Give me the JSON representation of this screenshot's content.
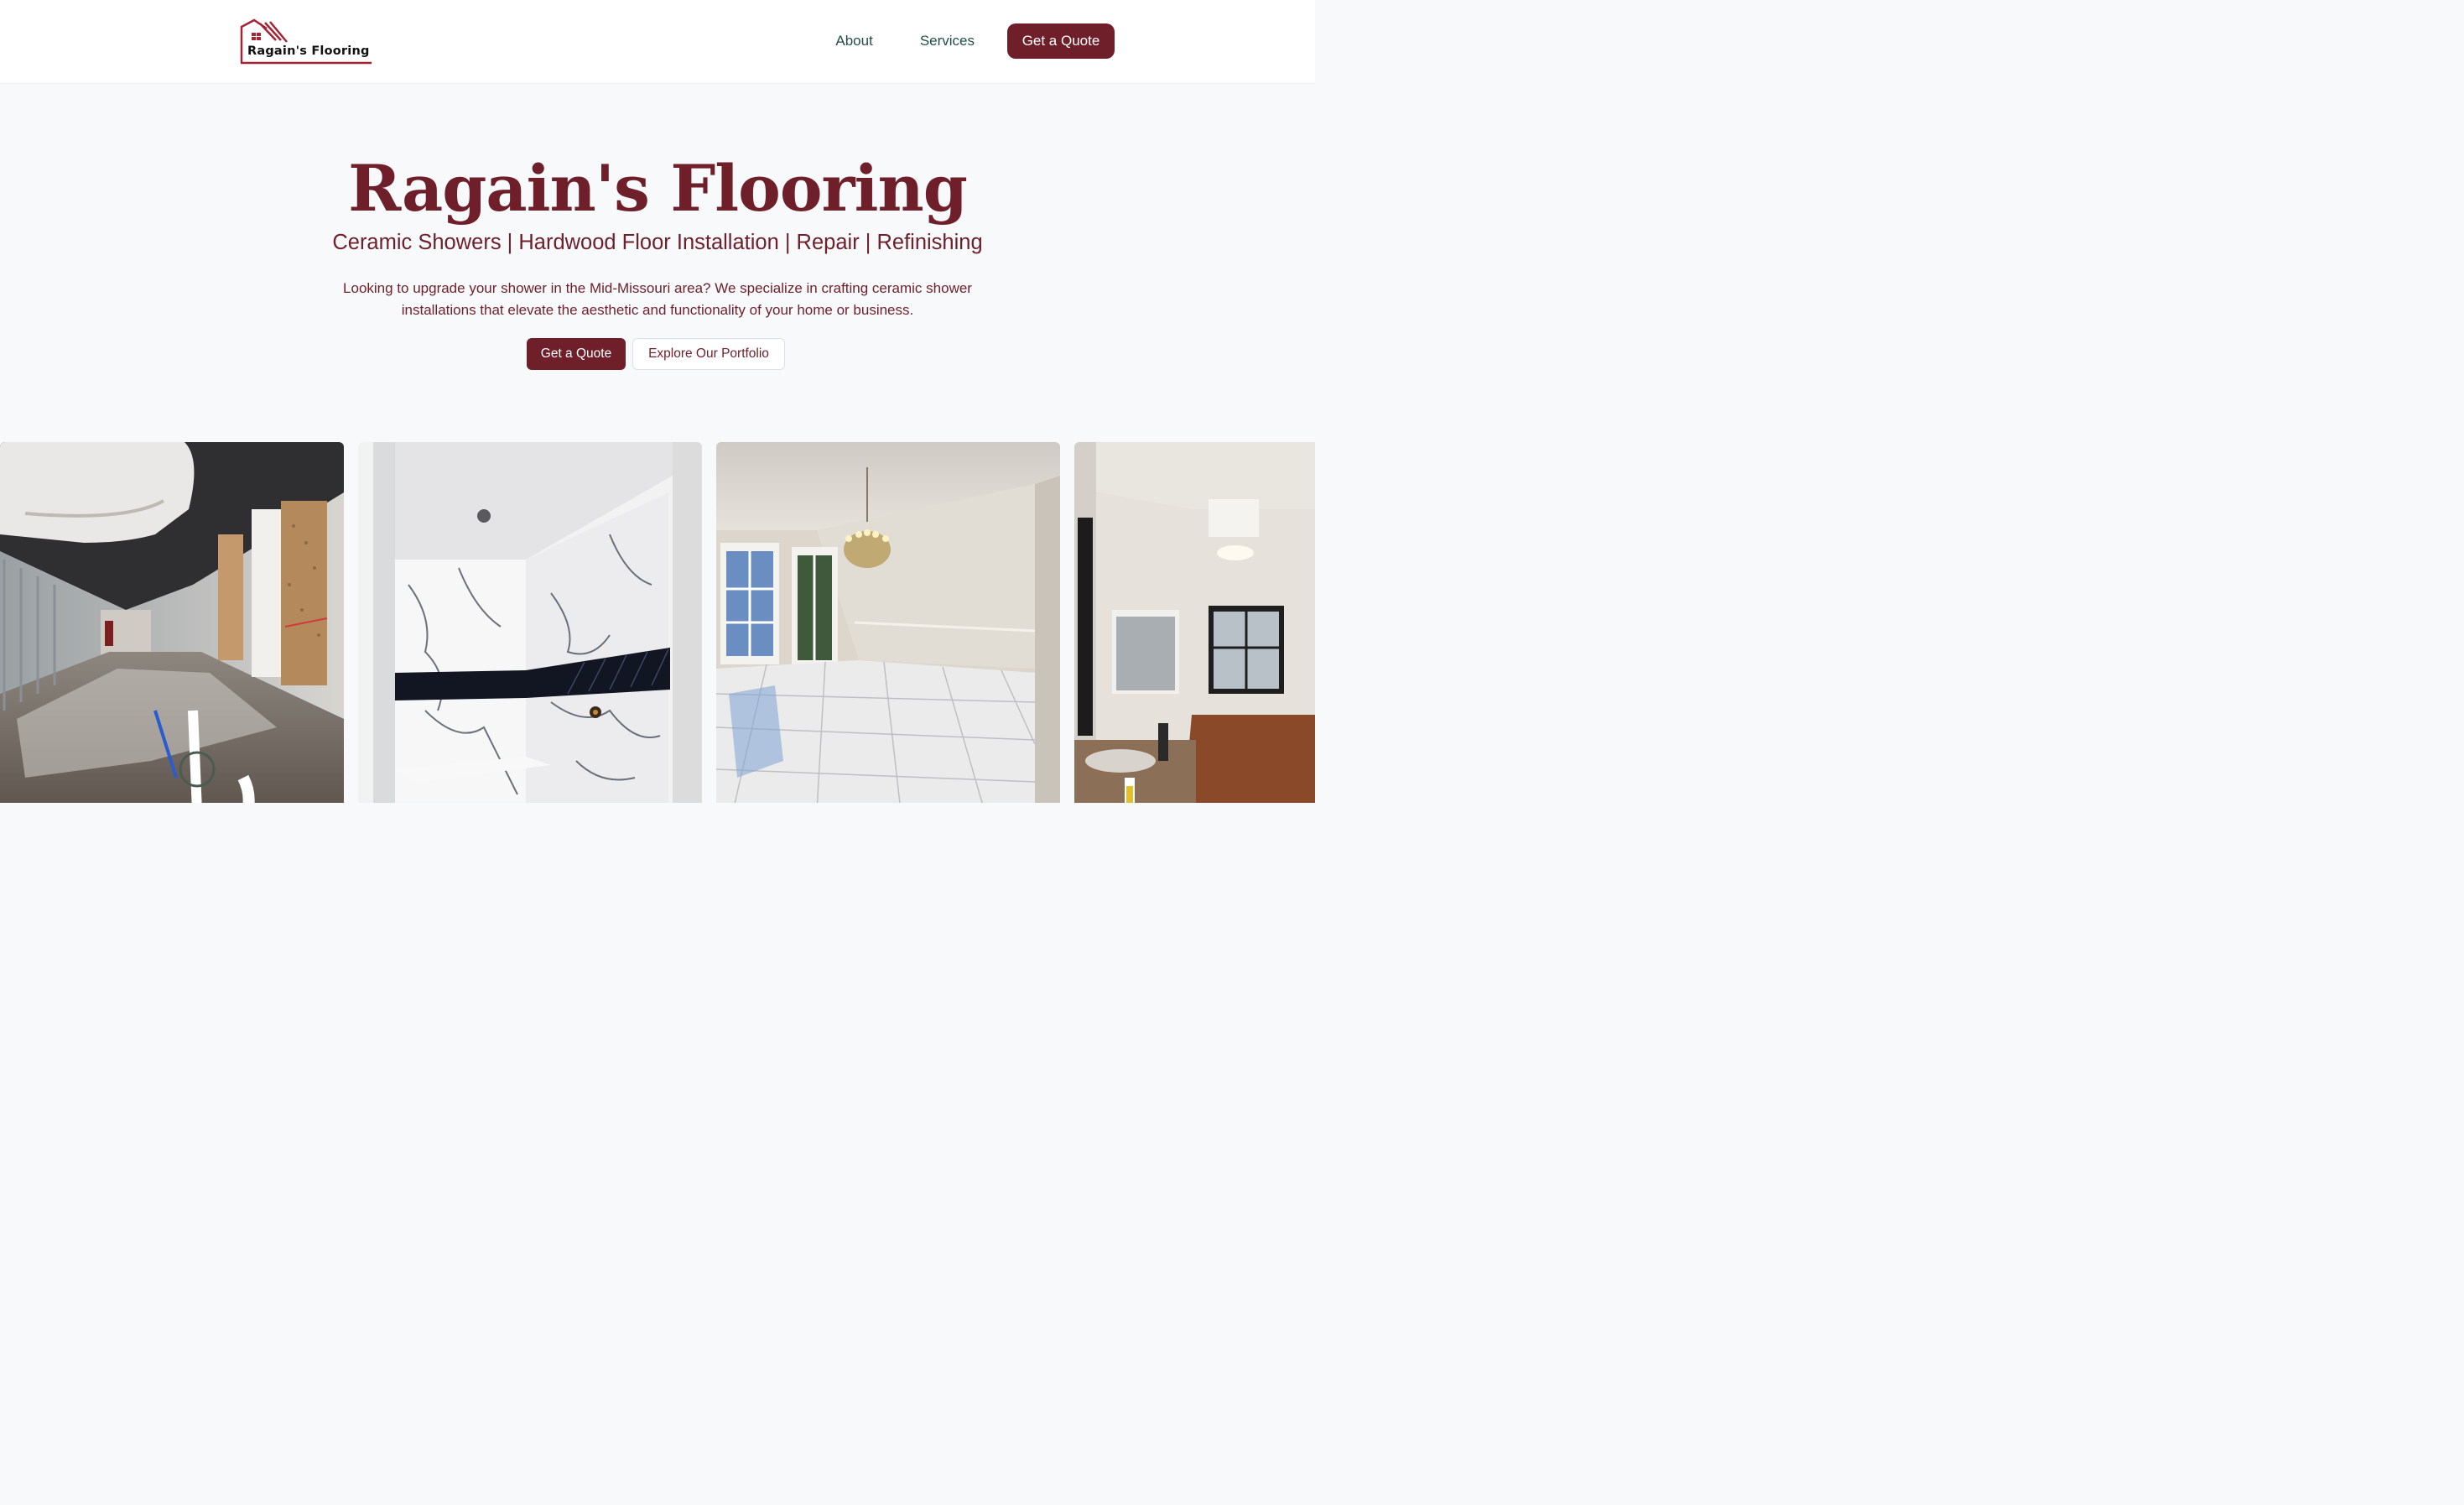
{
  "header": {
    "logo_text": "Ragain's Flooring",
    "nav": [
      {
        "label": "About"
      },
      {
        "label": "Services"
      }
    ],
    "cta_label": "Get a Quote"
  },
  "hero": {
    "title": "Ragain's Flooring",
    "subtitle": "Ceramic Showers | Hardwood Floor Installation | Repair | Refinishing",
    "description": "Looking to upgrade your shower in the Mid-Missouri area? We specialize in crafting ceramic shower installations that elevate the aesthetic and functionality of your home or business.",
    "primary_button": "Get a Quote",
    "secondary_button": "Explore Our Portfolio"
  },
  "colors": {
    "brand": "#6e1f2a",
    "nav_text": "#1f4f42",
    "background": "#f8f9fb"
  },
  "gallery": [
    {
      "icon": "commercial-renovation-photo"
    },
    {
      "icon": "marble-shower-photo"
    },
    {
      "icon": "tiled-dining-room-photo"
    },
    {
      "icon": "bathroom-photo"
    }
  ]
}
